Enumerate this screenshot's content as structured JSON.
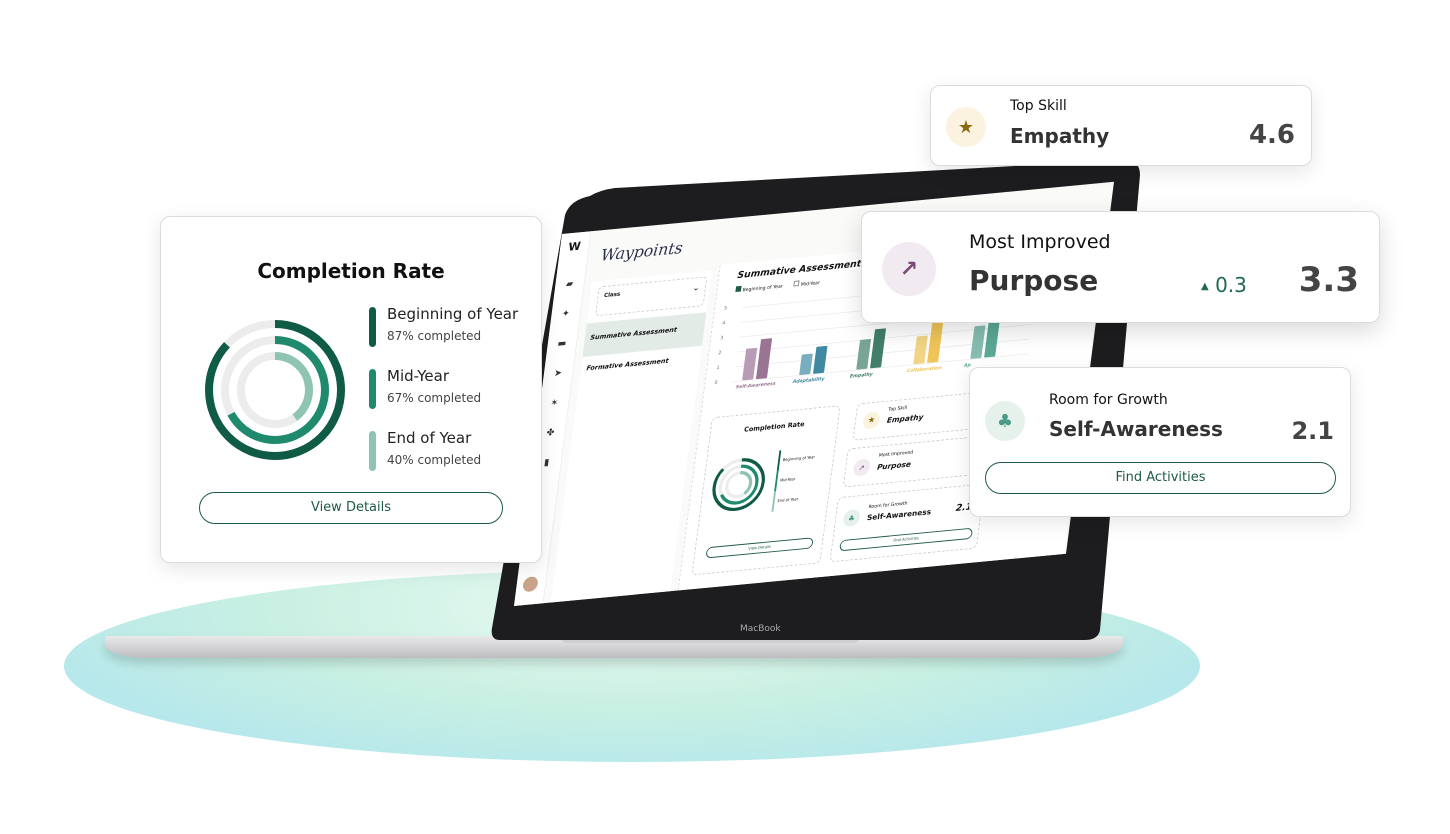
{
  "colors": {
    "dark_green": "#0f5b46",
    "mid_green": "#1f8a6e",
    "light_green": "#8fc4b3",
    "accent_text": "#1e5a48",
    "up_green": "#1e6a50"
  },
  "laptop": {
    "brand": "MacBook",
    "app_title": "Waypoints",
    "class_dropdown": {
      "label": "Class"
    },
    "nav": [
      {
        "label": "Summative Assessment",
        "active": true
      },
      {
        "label": "Formative Assessment",
        "active": false
      }
    ],
    "chart_title": "Summative Assessment",
    "legend": [
      {
        "label": "Beginning of Year",
        "checked": true
      },
      {
        "label": "Mid-Year",
        "checked": false
      }
    ],
    "chart_data": {
      "type": "bar",
      "categories": [
        "Self-Awareness",
        "Adaptability",
        "Empathy",
        "Collaboration",
        "Ap"
      ],
      "yticks": [
        "0",
        "1",
        "2",
        "3",
        "4",
        "5"
      ],
      "ylim": [
        0,
        5
      ],
      "series": [
        {
          "values": [
            2.1,
            1.4,
            2.0,
            1.9,
            2.2
          ]
        },
        {
          "values": [
            2.7,
            1.8,
            2.6,
            3.6,
            3.3
          ]
        }
      ],
      "category_colors": [
        [
          "#b89bb4",
          "#9a7494"
        ],
        [
          "#79aebe",
          "#3f8aa0"
        ],
        [
          "#78a596",
          "#417e6c"
        ],
        [
          "#f2d485",
          "#efc558"
        ],
        [
          "#86bdb0",
          "#5aa896"
        ]
      ]
    },
    "mini_completion": {
      "title": "Completion Rate",
      "items": [
        "Beginning of Year",
        "Mid-Year",
        "End of Year"
      ],
      "button": "View Details"
    },
    "mini_top": {
      "label": "Top Skill",
      "value": "Empathy"
    },
    "mini_improved": {
      "label": "Most Improved",
      "value": "Purpose"
    },
    "mini_growth": {
      "label": "Room for Growth",
      "value": "Self-Awareness",
      "score": "2.1",
      "button": "Find Activities"
    }
  },
  "completion_card": {
    "title": "Completion Rate",
    "items": [
      {
        "label": "Beginning of Year",
        "sub": "87% completed",
        "percent": 87,
        "color": "#0f5b46"
      },
      {
        "label": "Mid-Year",
        "sub": "67% completed",
        "percent": 67,
        "color": "#1f8a6e"
      },
      {
        "label": "End of Year",
        "sub": "40% completed",
        "percent": 40,
        "color": "#8fc4b3"
      }
    ],
    "button": "View Details"
  },
  "top_skill": {
    "label": "Top Skill",
    "value": "Empathy",
    "score": "4.6",
    "icon": "star-icon"
  },
  "most_improved": {
    "label": "Most Improved",
    "value": "Purpose",
    "delta": "0.3",
    "score": "3.3",
    "icon": "trending-up-icon"
  },
  "room_for_growth": {
    "label": "Room for Growth",
    "value": "Self-Awareness",
    "score": "2.1",
    "button": "Find Activities",
    "icon": "sprout-icon"
  }
}
